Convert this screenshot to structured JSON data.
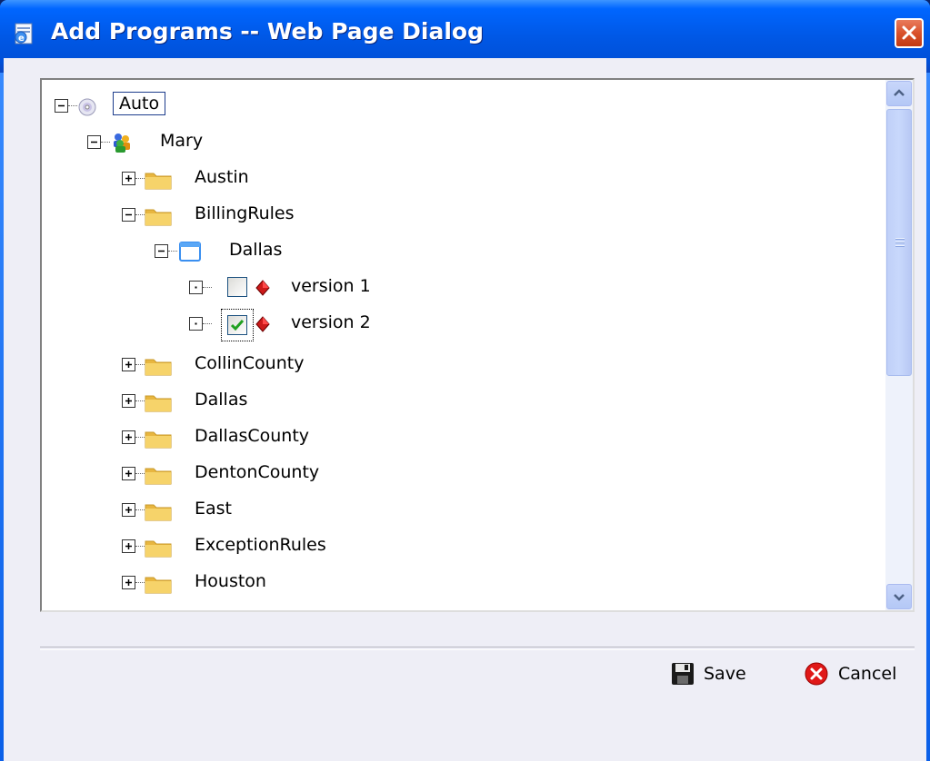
{
  "window": {
    "title": "Add Programs -- Web Page Dialog"
  },
  "tree": {
    "nodes": [
      {
        "label": "Auto",
        "icon": "disc-icon",
        "state": "expanded",
        "selected": true
      },
      {
        "label": "Mary",
        "icon": "people-group-icon",
        "state": "expanded"
      },
      {
        "label": "Austin",
        "icon": "folder-icon",
        "state": "collapsed"
      },
      {
        "label": "BillingRules",
        "icon": "folder-icon",
        "state": "expanded"
      },
      {
        "label": "Dallas",
        "icon": "window-icon",
        "state": "expanded"
      },
      {
        "label": "version 1",
        "icon": "red-diamond-icon",
        "state": "leaf",
        "checked": false
      },
      {
        "label": "version 2",
        "icon": "red-diamond-icon",
        "state": "leaf",
        "checked": true
      },
      {
        "label": "CollinCounty",
        "icon": "folder-icon",
        "state": "collapsed"
      },
      {
        "label": "Dallas",
        "icon": "folder-icon",
        "state": "collapsed"
      },
      {
        "label": "DallasCounty",
        "icon": "folder-icon",
        "state": "collapsed"
      },
      {
        "label": "DentonCounty",
        "icon": "folder-icon",
        "state": "collapsed"
      },
      {
        "label": "East",
        "icon": "folder-icon",
        "state": "collapsed"
      },
      {
        "label": "ExceptionRules",
        "icon": "folder-icon",
        "state": "collapsed"
      },
      {
        "label": "Houston",
        "icon": "folder-icon",
        "state": "collapsed"
      }
    ]
  },
  "footer": {
    "save_label": "Save",
    "cancel_label": "Cancel"
  },
  "colors": {
    "titlebar": "#0058e6",
    "close": "#d9522c",
    "folder": "#f3cc5a",
    "body_bg": "#eeeef6"
  }
}
